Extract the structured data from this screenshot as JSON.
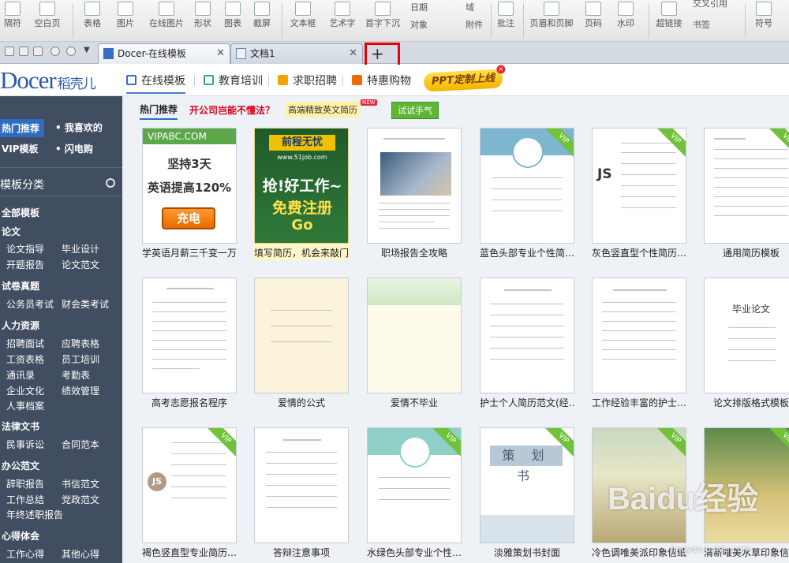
{
  "ribbon": {
    "items": [
      {
        "label": "隔符",
        "icon": "page-break-icon"
      },
      {
        "label": "空白页",
        "icon": "blank-page-icon"
      },
      {
        "label": "表格",
        "icon": "table-icon"
      },
      {
        "label": "图片",
        "icon": "picture-icon"
      },
      {
        "label": "在线图片",
        "icon": "online-picture-icon"
      },
      {
        "label": "形状",
        "icon": "shape-icon"
      },
      {
        "label": "图表",
        "icon": "chart-icon"
      },
      {
        "label": "截屏",
        "icon": "screenshot-icon"
      },
      {
        "label": "文本框",
        "icon": "textbox-icon"
      },
      {
        "label": "艺术字",
        "icon": "wordart-icon"
      },
      {
        "label": "首字下沉",
        "icon": "dropcap-icon"
      },
      {
        "label": "批注",
        "icon": "comment-icon"
      },
      {
        "label": "页眉和页脚",
        "icon": "header-footer-icon"
      },
      {
        "label": "页码",
        "icon": "page-number-icon"
      },
      {
        "label": "水印",
        "icon": "watermark-icon"
      },
      {
        "label": "超链接",
        "icon": "hyperlink-icon"
      },
      {
        "label": "符号",
        "icon": "symbol-icon"
      }
    ],
    "small": {
      "date": "日期",
      "field": "域",
      "object": "对象",
      "attachment": "附件",
      "crossref": "交叉引用",
      "bookmark": "书签"
    }
  },
  "tabs": {
    "tab1": "Docer-在线模板",
    "tab2": "文档1",
    "new_tab": "+"
  },
  "header": {
    "logo_main": "Docer",
    "logo_sub": "稻壳儿",
    "nav": [
      "在线模板",
      "教育培训",
      "求职招聘",
      "特惠购物"
    ],
    "ppt_button": "PPT定制上线"
  },
  "sidebar": {
    "top": [
      "热门推荐",
      "我喜欢的",
      "VIP模板",
      "闪电购"
    ],
    "section_title": "模板分类",
    "all": "全部模板",
    "groups": [
      {
        "title": "论文",
        "items": [
          "论文指导",
          "毕业设计",
          "开题报告",
          "论文范文"
        ]
      },
      {
        "title": "试卷真题",
        "items": [
          "公务员考试",
          "财会类考试"
        ]
      },
      {
        "title": "人力资源",
        "items": [
          "招聘面试",
          "应聘表格",
          "工资表格",
          "员工培训",
          "通讯录",
          "考勤表",
          "企业文化",
          "绩效管理",
          "人事档案"
        ]
      },
      {
        "title": "法律文书",
        "items": [
          "民事诉讼",
          "合同范本"
        ]
      },
      {
        "title": "办公范文",
        "items": [
          "辞职报告",
          "书信范文",
          "工作总结",
          "党政范文",
          "年终述职报告"
        ]
      },
      {
        "title": "心得体会",
        "items": [
          "工作心得",
          "其他心得"
        ]
      }
    ]
  },
  "content": {
    "hot_label": "热门推荐",
    "red_text": "开公司岂能不懂法？",
    "yellow_text": "高端精致英文简历",
    "new_badge": "NEW",
    "green_button": "试试手气",
    "vip_badge": "VIP",
    "cards": [
      "学英语月薪三千变一万",
      "填写简历，机会来敲门",
      "职场报告全攻略",
      "蓝色头部专业个性简…",
      "灰色竖直型个性简历…",
      "通用简历模板",
      "高考志愿报名程序",
      "爱情的公式",
      "爱情不毕业",
      "护士个人简历范文(经…",
      "工作经验丰富的护士…",
      "论文排版格式模板",
      "褐色竖直型专业简历…",
      "答辩注意事项",
      "水绿色头部专业个性…",
      "淡雅策划书封面",
      "冷色调唯美派印象信纸",
      "清新唯美水草印象信纸"
    ],
    "ad1": {
      "top": "VIPABC.COM",
      "line1": "坚持3天",
      "line2": "英语提高120%",
      "button": "充电"
    },
    "ad2": {
      "top": "前程无忧",
      "domain": "www.51job.com",
      "line1": "抢!好工作~",
      "line2": "免费注册",
      "go": "Go"
    },
    "plan_title": "策 划 书",
    "thesis_title": "毕业论文"
  },
  "watermark": {
    "main": "Baidu经验",
    "sub": "jingyan.baidu.com"
  }
}
